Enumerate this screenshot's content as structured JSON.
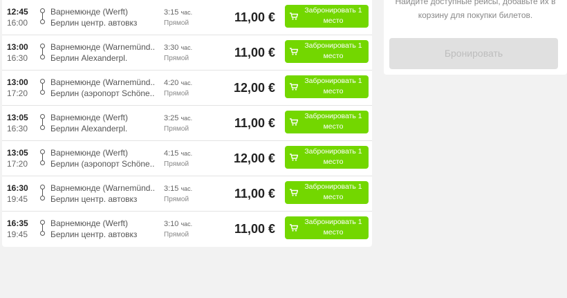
{
  "sidebar": {
    "hint_line1": "Найдите доступные рейсы, добавьте их в",
    "hint_line2": "корзину для покупки билетов.",
    "book_button": "Бронировать"
  },
  "duration_unit": "час.",
  "cart_icon": "cart-icon",
  "accent_color": "#73d700",
  "trips": [
    {
      "dep_time": "12:45",
      "arr_time": "16:00",
      "from": "Варнемюнде (Werft)",
      "to": "Берлин центр. автовкз",
      "duration": "3:15",
      "type": "Прямой",
      "price": "11,00 €",
      "button_line1": "Забронировать 1",
      "button_line2": "место"
    },
    {
      "dep_time": "13:00",
      "arr_time": "16:30",
      "from": "Варнемюнде (Warnemünd...",
      "to": "Берлин Alexanderpl.",
      "duration": "3:30",
      "type": "Прямой",
      "price": "11,00 €",
      "button_line1": "Забронировать 1",
      "button_line2": "место"
    },
    {
      "dep_time": "13:00",
      "arr_time": "17:20",
      "from": "Варнемюнде (Warnemünd...",
      "to": "Берлин (аэропорт Schöne...",
      "duration": "4:20",
      "type": "Прямой",
      "price": "12,00 €",
      "button_line1": "Забронировать 1",
      "button_line2": "место"
    },
    {
      "dep_time": "13:05",
      "arr_time": "16:30",
      "from": "Варнемюнде (Werft)",
      "to": "Берлин Alexanderpl.",
      "duration": "3:25",
      "type": "Прямой",
      "price": "11,00 €",
      "button_line1": "Забронировать 1",
      "button_line2": "место"
    },
    {
      "dep_time": "13:05",
      "arr_time": "17:20",
      "from": "Варнемюнде (Werft)",
      "to": "Берлин (аэропорт Schöne...",
      "duration": "4:15",
      "type": "Прямой",
      "price": "12,00 €",
      "button_line1": "Забронировать 1",
      "button_line2": "место"
    },
    {
      "dep_time": "16:30",
      "arr_time": "19:45",
      "from": "Варнемюнде (Warnemünd...",
      "to": "Берлин центр. автовкз",
      "duration": "3:15",
      "type": "Прямой",
      "price": "11,00 €",
      "button_line1": "Забронировать 1",
      "button_line2": "место"
    },
    {
      "dep_time": "16:35",
      "arr_time": "19:45",
      "from": "Варнемюнде (Werft)",
      "to": "Берлин центр. автовкз",
      "duration": "3:10",
      "type": "Прямой",
      "price": "11,00 €",
      "button_line1": "Забронировать 1",
      "button_line2": "место"
    }
  ]
}
